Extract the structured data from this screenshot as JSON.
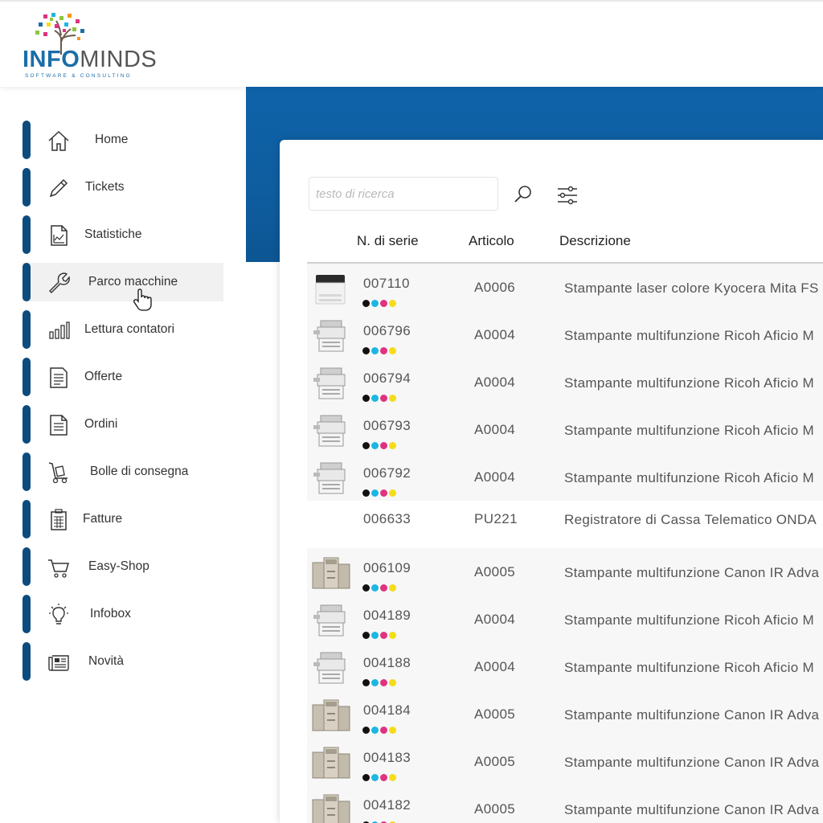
{
  "brand": {
    "name_part1": "INFO",
    "name_part2": "MINDS",
    "tagline": "SOFTWARE & CONSULTING"
  },
  "colors": {
    "primary_blue": "#0e5d9f",
    "nav_bar": "#0c4b7e",
    "toner_black": "#111111",
    "toner_cyan": "#1cb6e3",
    "toner_magenta": "#e0327f",
    "toner_yellow": "#f5dc1a"
  },
  "sidebar": {
    "items": [
      {
        "label": "Home",
        "icon": "home-icon",
        "active": false
      },
      {
        "label": "Tickets",
        "icon": "pencil-icon",
        "active": false
      },
      {
        "label": "Statistiche",
        "icon": "chart-document-icon",
        "active": false
      },
      {
        "label": "Parco macchine",
        "icon": "wrench-icon",
        "active": true
      },
      {
        "label": "Lettura contatori",
        "icon": "bar-chart-icon",
        "active": false
      },
      {
        "label": "Offerte",
        "icon": "document-icon",
        "active": false
      },
      {
        "label": "Ordini",
        "icon": "document-lines-icon",
        "active": false
      },
      {
        "label": "Bolle di consegna",
        "icon": "hand-truck-icon",
        "active": false
      },
      {
        "label": "Fatture",
        "icon": "calculator-icon",
        "active": false
      },
      {
        "label": "Easy-Shop",
        "icon": "cart-icon",
        "active": false
      },
      {
        "label": "Infobox",
        "icon": "lightbulb-icon",
        "active": false
      },
      {
        "label": "Novità",
        "icon": "newspaper-icon",
        "active": false
      }
    ]
  },
  "search": {
    "placeholder": "testo di ricerca",
    "value": ""
  },
  "table": {
    "headers": [
      "N. di serie",
      "Articolo",
      "Descrizione"
    ],
    "rows": [
      {
        "serial": "007110",
        "article": "A0006",
        "description": "Stampante laser colore Kyocera Mita FS",
        "image": "kyocera",
        "toner": true
      },
      {
        "serial": "006796",
        "article": "A0004",
        "description": "Stampante multifunzione Ricoh Aficio M",
        "image": "ricoh",
        "toner": true
      },
      {
        "serial": "006794",
        "article": "A0004",
        "description": "Stampante multifunzione Ricoh Aficio M",
        "image": "ricoh",
        "toner": true
      },
      {
        "serial": "006793",
        "article": "A0004",
        "description": "Stampante multifunzione Ricoh Aficio M",
        "image": "ricoh",
        "toner": true
      },
      {
        "serial": "006792",
        "article": "A0004",
        "description": "Stampante multifunzione Ricoh Aficio M",
        "image": "ricoh",
        "toner": true
      },
      {
        "serial": "006633",
        "article": "PU221",
        "description": "Registratore di Cassa Telematico ONDA",
        "image": "none",
        "toner": false
      },
      {
        "serial": "006109",
        "article": "A0005",
        "description": "Stampante multifunzione Canon IR Adva",
        "image": "canon",
        "toner": true
      },
      {
        "serial": "004189",
        "article": "A0004",
        "description": "Stampante multifunzione Ricoh Aficio M",
        "image": "ricoh",
        "toner": true
      },
      {
        "serial": "004188",
        "article": "A0004",
        "description": "Stampante multifunzione Ricoh Aficio M",
        "image": "ricoh",
        "toner": true
      },
      {
        "serial": "004184",
        "article": "A0005",
        "description": "Stampante multifunzione Canon IR Adva",
        "image": "canon",
        "toner": true
      },
      {
        "serial": "004183",
        "article": "A0005",
        "description": "Stampante multifunzione Canon IR Adva",
        "image": "canon",
        "toner": true
      },
      {
        "serial": "004182",
        "article": "A0005",
        "description": "Stampante multifunzione Canon IR Adva",
        "image": "canon",
        "toner": true
      }
    ]
  }
}
